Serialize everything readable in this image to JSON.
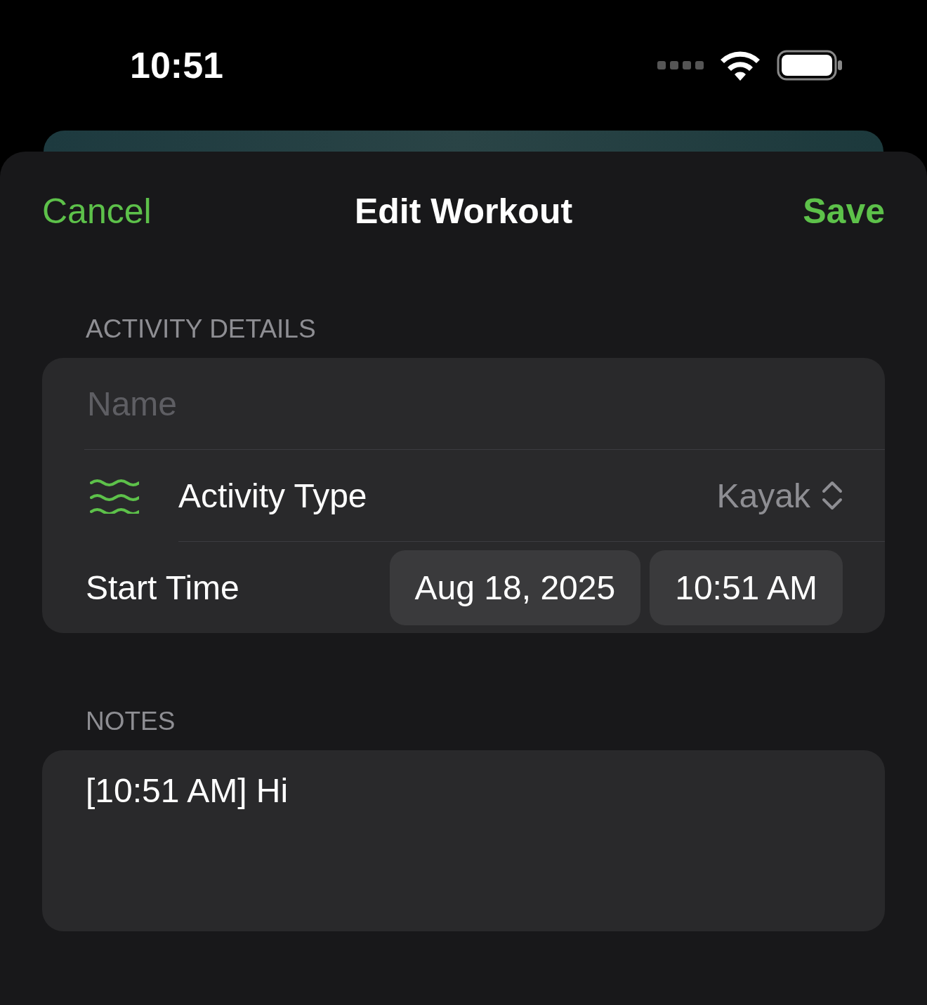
{
  "status_bar": {
    "time": "10:51"
  },
  "nav": {
    "cancel": "Cancel",
    "title": "Edit Workout",
    "save": "Save"
  },
  "activity_details": {
    "header": "ACTIVITY DETAILS",
    "name": {
      "placeholder": "Name"
    },
    "activity_type": {
      "label": "Activity Type",
      "value": "Kayak"
    },
    "start_time": {
      "label": "Start Time",
      "date": "Aug 18, 2025",
      "time": "10:51 AM"
    }
  },
  "notes": {
    "header": "NOTES",
    "value": "[10:51 AM] Hi"
  }
}
